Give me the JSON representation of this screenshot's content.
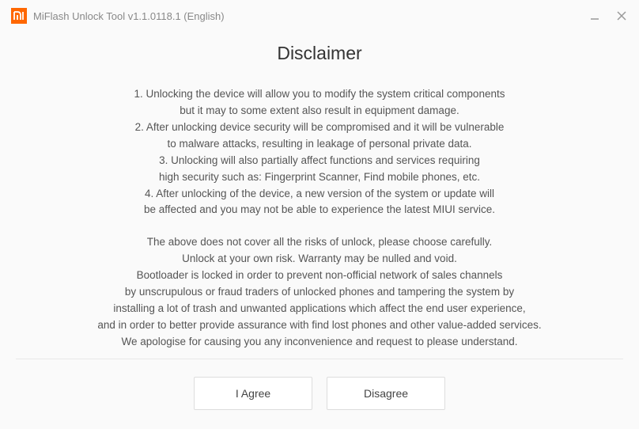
{
  "window": {
    "title": "MiFlash Unlock Tool v1.1.0118.1 (English)"
  },
  "heading": "Disclaimer",
  "lines": {
    "l1": "1. Unlocking the device will allow you to modify the system critical components",
    "l2": "but it may to some extent also result in equipment damage.",
    "l3": "2. After unlocking device security will be compromised and it will be vulnerable",
    "l4": "to malware attacks, resulting in leakage of personal private data.",
    "l5": "3. Unlocking will also partially affect functions and services requiring",
    "l6": "high security such as: Fingerprint Scanner, Find mobile phones, etc.",
    "l7": "4. After unlocking of the device, a new version of the system or update will",
    "l8": "be affected and you may not be able to experience the latest MIUI service.",
    "l9": "The above does not cover all the risks of unlock, please choose carefully.",
    "l10": "Unlock at your own risk. Warranty may be nulled and void.",
    "l11": "Bootloader is locked in order to prevent non-official network of sales channels",
    "l12": "by unscrupulous or fraud traders of unlocked phones and tampering the system by",
    "l13": "installing a lot of trash and unwanted applications which affect the end user experience,",
    "l14": "and in order to better provide assurance with find lost phones and other value-added services.",
    "l15": "We apologise for causing you any inconvenience and request to please understand."
  },
  "buttons": {
    "agree": "I Agree",
    "disagree": "Disagree"
  }
}
